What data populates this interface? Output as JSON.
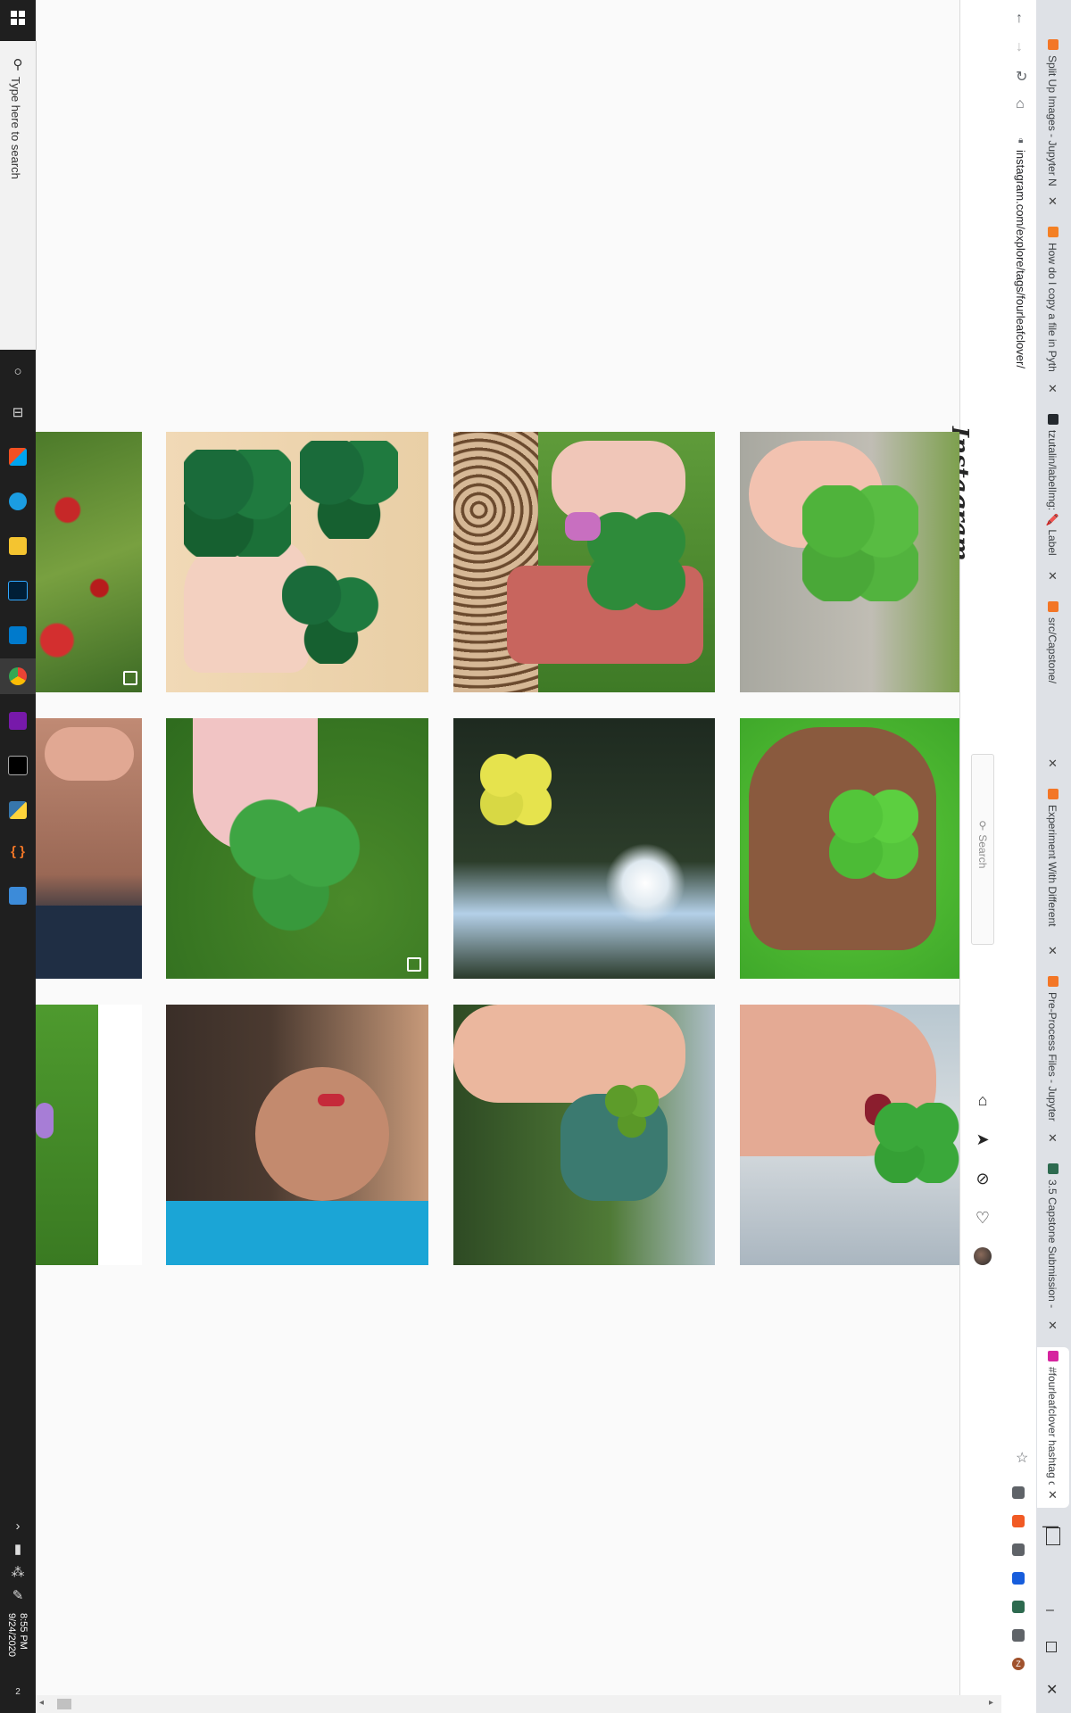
{
  "taskbar": {
    "search_placeholder": "Type here to search",
    "time": "8:55 PM",
    "date": "9/24/2020",
    "notification_count": "2",
    "apps": [
      "windows-logo",
      "search",
      "cortana",
      "task-view",
      "microsoft-store",
      "edge",
      "file-explorer",
      "photoshop",
      "vscode",
      "chrome",
      "onenote",
      "terminal",
      "python",
      "brackets",
      "calculator"
    ]
  },
  "browser": {
    "url": "instagram.com/explore/tags/fourleafclover/",
    "tabs": [
      {
        "title": "Split Up Images - Jupyter N",
        "color": "#f37626"
      },
      {
        "title": "How do I copy a file in Pyth",
        "color": "#f48024"
      },
      {
        "title": "tzutalin/labelImg: 🖍️ Label",
        "color": "#24292e"
      },
      {
        "title": "src/Capstone/",
        "color": "#f37626"
      },
      {
        "title": "Experiment With Different",
        "color": "#f37626"
      },
      {
        "title": "Pre-Process Files - Jupyter",
        "color": "#f37626"
      },
      {
        "title": "3.5 Capstone Submission -",
        "color": "#2d6a4f"
      },
      {
        "title": "#fourleafclover hashtag on",
        "color": "#d6249f"
      }
    ],
    "extensions": [
      "star",
      "g-extension",
      "honey",
      "privacy",
      "bitwarden",
      "screenshot",
      "puzzle",
      "profile"
    ],
    "profile_letter": "Z"
  },
  "instagram": {
    "logo": "Instagram",
    "search_placeholder": "Search",
    "nav_icons": [
      "home-icon",
      "direct-icon",
      "explore-icon",
      "activity-icon",
      "profile-avatar"
    ]
  },
  "colors": {
    "background": "#fafafa",
    "taskbar": "#1f1f1f",
    "tabstrip": "#dee1e6",
    "clover": "#2e8b3a"
  }
}
